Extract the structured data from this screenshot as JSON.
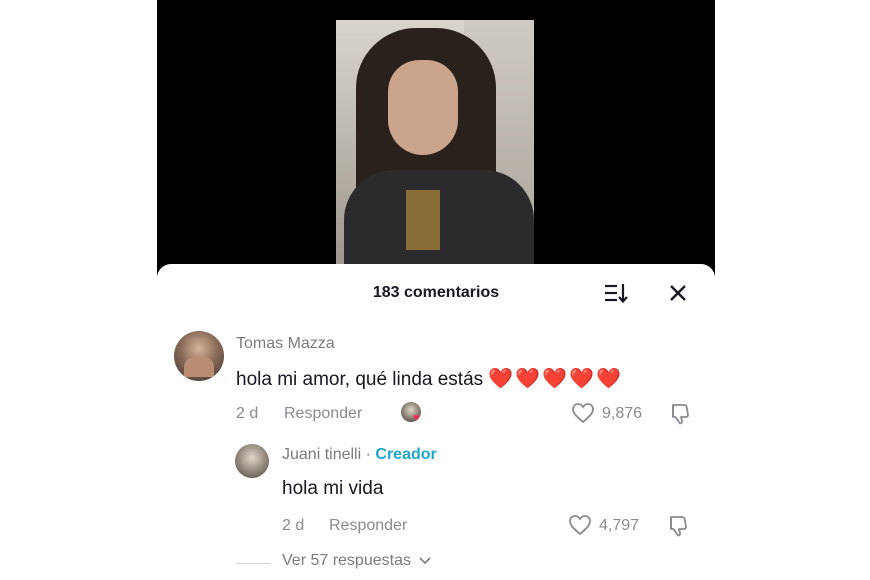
{
  "header": {
    "title": "183 comentarios"
  },
  "comment": {
    "username": "Tomas Mazza",
    "text": "hola mi amor, qué linda estás",
    "emojis": "❤️❤️❤️❤️❤️",
    "time": "2 d",
    "reply_label": "Responder",
    "likes": "9,876"
  },
  "reply": {
    "username": "Juani tinelli",
    "separator": "·",
    "badge": "Creador",
    "text": "hola mi vida",
    "time": "2 d",
    "reply_label": "Responder",
    "likes": "4,797"
  },
  "view_replies": {
    "label": "Ver 57 respuestas"
  },
  "colors": {
    "creator_badge": "#20a6c9",
    "heart": "#e3232e",
    "muted": "#8a8b91",
    "text": "#161823"
  }
}
